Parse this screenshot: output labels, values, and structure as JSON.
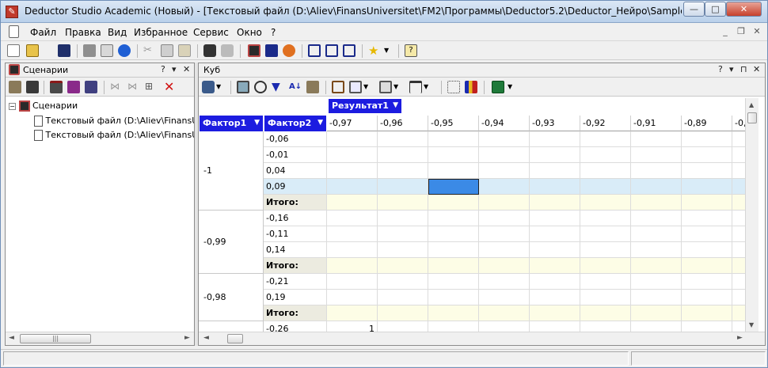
{
  "window": {
    "title": "Deductor Studio Academic (Новый) - [Текстовый файл (D:\\Aliev\\FinansUniversitet\\FM2\\Программы\\Deductor5.2\\Deductor_Нейро\\Samples\\TestForCPP...",
    "min": "—",
    "max": "□",
    "close": "✕"
  },
  "menu": {
    "items": [
      "Файл",
      "Правка",
      "Вид",
      "Избранное",
      "Сервис",
      "Окно",
      "?"
    ],
    "mdi_min": "_",
    "mdi_restore": "❐",
    "mdi_close": "✕"
  },
  "left_pane": {
    "title": "Сценарии",
    "help": "?",
    "pin": "▾",
    "close": "✕",
    "tree_root": "Сценарии",
    "tree_items": [
      "Текстовый файл (D:\\Aliev\\FinansUni",
      "Текстовый файл (D:\\Aliev\\FinansUni"
    ],
    "scroll_thumb": "|||"
  },
  "right_pane": {
    "title": "Куб",
    "help": "?",
    "pin": "▾",
    "float": "⊓",
    "close": "✕",
    "scroll_thumb": "|||"
  },
  "cube": {
    "measure_label": "Результат1",
    "row_field_1": "Фактор1",
    "row_field_2": "Фактор2",
    "columns": [
      "-0,97",
      "-0,96",
      "-0,95",
      "-0,94",
      "-0,93",
      "-0,92",
      "-0,91",
      "-0,89",
      "-0,"
    ],
    "groups": [
      {
        "factor1": "-1",
        "rows": [
          "-0,06",
          "-0,01",
          "0,04",
          "0,09",
          "Итого:"
        ]
      },
      {
        "factor1": "-0,99",
        "rows": [
          "-0,16",
          "-0,11",
          "0,14",
          "Итого:"
        ]
      },
      {
        "factor1": "-0,98",
        "rows": [
          "-0,21",
          "0,19",
          "Итого:"
        ]
      },
      {
        "factor1": "",
        "rows": [
          "-0,26"
        ]
      }
    ],
    "cell_value_last_row": "1"
  },
  "colors": {
    "header_blue": "#1c1ce0",
    "selected_row": "#d9ecf8",
    "selected_cell": "#3b8ae6",
    "total_row": "#fdfde6"
  }
}
